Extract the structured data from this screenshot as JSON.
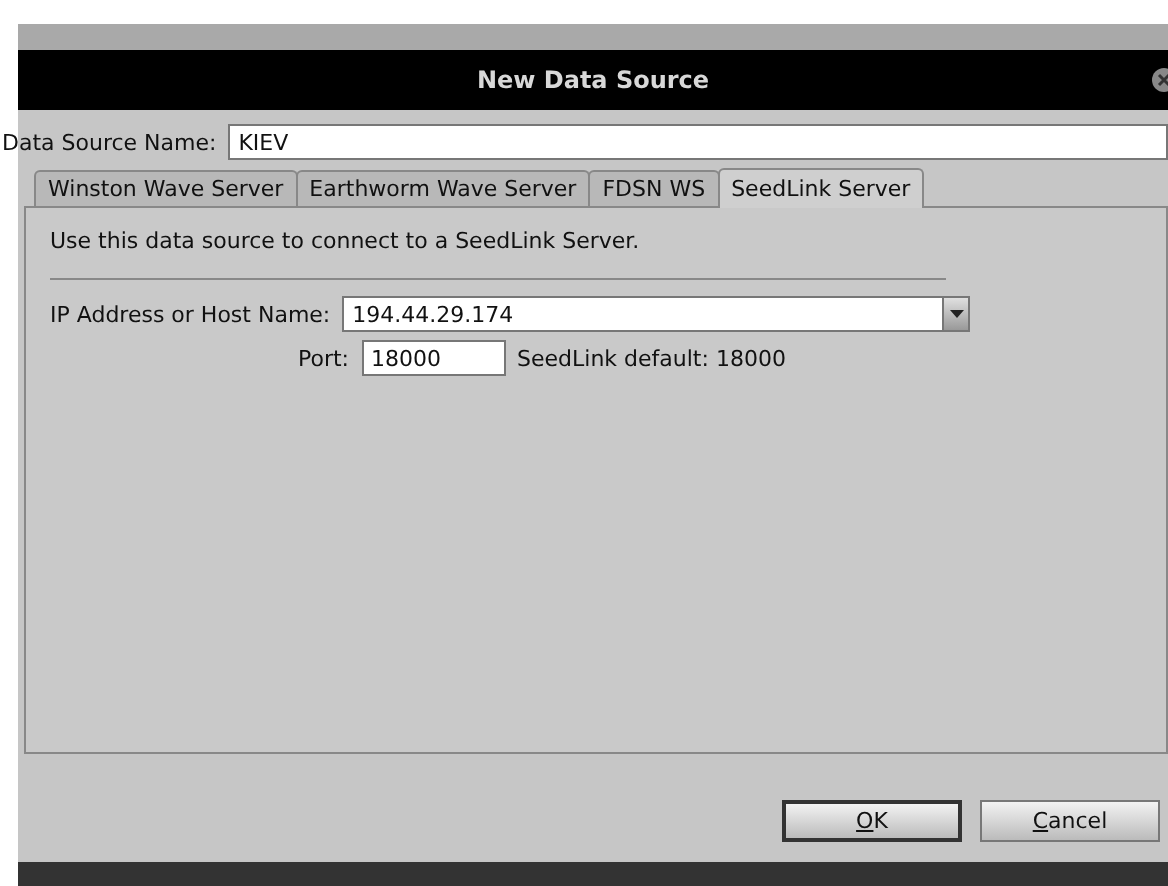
{
  "window": {
    "title": "New Data Source"
  },
  "name_field": {
    "label": "Data Source Name:",
    "value": "KIEV"
  },
  "tabs": [
    {
      "label": "Winston Wave Server",
      "selected": false
    },
    {
      "label": "Earthworm Wave Server",
      "selected": false
    },
    {
      "label": "FDSN WS",
      "selected": false
    },
    {
      "label": "SeedLink Server",
      "selected": true
    }
  ],
  "panel": {
    "description": "Use this data source to connect to a SeedLink Server.",
    "host": {
      "label": "IP Address or Host Name:",
      "value": "194.44.29.174"
    },
    "port": {
      "label": "Port:",
      "value": "18000",
      "hint": "SeedLink default: 18000"
    }
  },
  "buttons": [
    {
      "label": "OK",
      "default": true
    },
    {
      "label": "Cancel",
      "default": false
    }
  ]
}
